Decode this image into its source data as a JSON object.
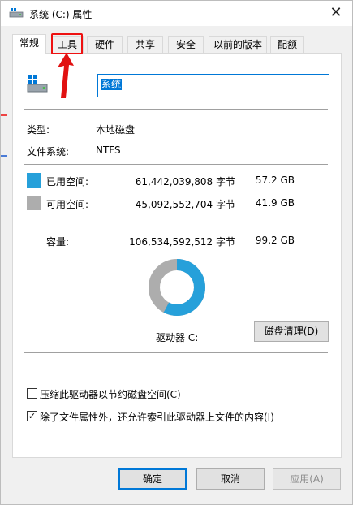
{
  "window": {
    "title": "系统 (C:) 属性",
    "close_glyph": "✕"
  },
  "tabs": [
    {
      "label": "常规",
      "active": true
    },
    {
      "label": "工具",
      "active": false
    },
    {
      "label": "硬件",
      "active": false
    },
    {
      "label": "共享",
      "active": false
    },
    {
      "label": "安全",
      "active": false
    },
    {
      "label": "以前的版本",
      "active": false
    },
    {
      "label": "配额",
      "active": false
    }
  ],
  "general": {
    "volume_name": "系统",
    "type_label": "类型:",
    "type_value": "本地磁盘",
    "fs_label": "文件系统:",
    "fs_value": "NTFS",
    "used": {
      "label": "已用空间:",
      "bytes": "61,442,039,808 字节",
      "size": "57.2 GB",
      "color": "#26a0da"
    },
    "free": {
      "label": "可用空间:",
      "bytes": "45,092,552,704 字节",
      "size": "41.9 GB",
      "color": "#adadad"
    },
    "capacity": {
      "label": "容量:",
      "bytes": "106,534,592,512 字节",
      "size": "99.2 GB"
    },
    "used_fraction": 0.5767,
    "drive_label": "驱动器 C:",
    "cleanup_button": "磁盘清理(D)",
    "compress_option": {
      "label": "压缩此驱动器以节约磁盘空间(C)",
      "checked": false
    },
    "index_option": {
      "label": "除了文件属性外，还允许索引此驱动器上文件的内容(I)",
      "checked": true
    }
  },
  "footer": {
    "ok": "确定",
    "cancel": "取消",
    "apply": "应用(A)"
  },
  "colors": {
    "accent": "#0078d7",
    "annotation": "#e11111"
  },
  "annotation": {
    "highlighted_tab": "工具"
  }
}
